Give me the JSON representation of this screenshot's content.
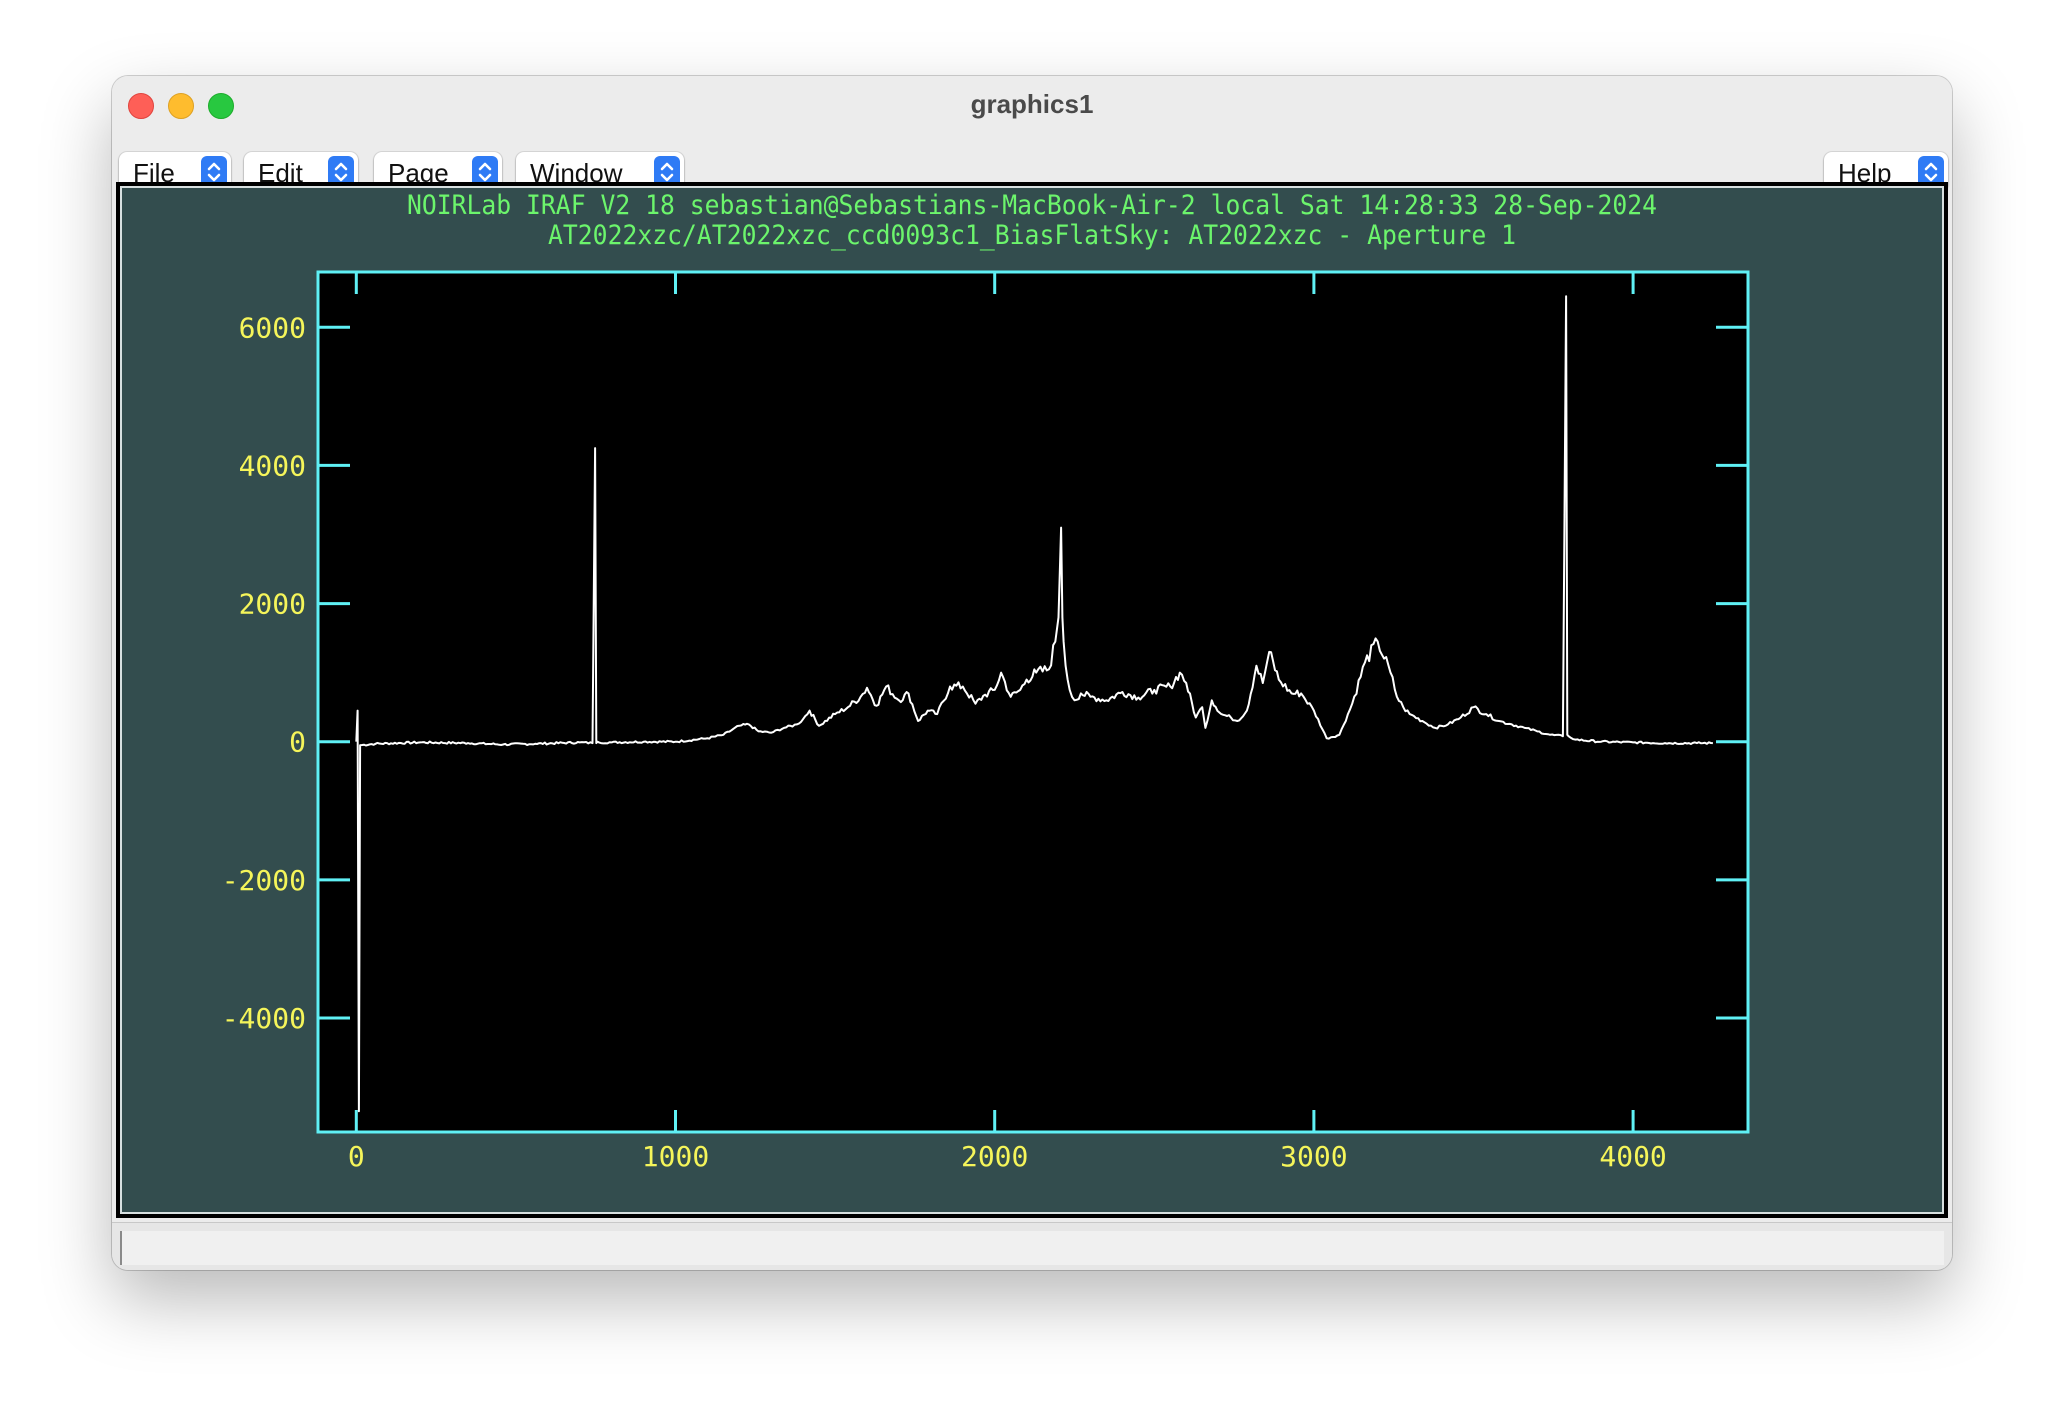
{
  "window": {
    "title": "graphics1"
  },
  "menus": {
    "file": "File",
    "edit": "Edit",
    "page": "Page",
    "window": "Window",
    "help": "Help"
  },
  "status": {
    "text": ""
  },
  "colors": {
    "plot_background": "#000000",
    "frame_background": "#334d4e",
    "axes": "#5ff0f5",
    "tick_labels": "#f5f55a",
    "title_text": "#6cf56c",
    "trace": "#ffffff",
    "menu_spinner": "#2f7bf5"
  },
  "icons": {
    "close": "close-traffic-light-icon",
    "minimize": "minimize-traffic-light-icon",
    "zoom": "zoom-traffic-light-icon",
    "menu_spinner": "chevron-updown-icon"
  },
  "chart_data": {
    "type": "line",
    "title": "NOIRLab IRAF V2 18 sebastian@Sebastians-MacBook-Air-2 local Sat 14:28:33 28-Sep-2024",
    "subtitle": "AT2022xzc/AT2022xzc_ccd0093c1_BiasFlatSky: AT2022xzc - Aperture 1",
    "xlabel": "",
    "ylabel": "",
    "xlim": [
      -120,
      4360
    ],
    "ylim": [
      -5650,
      6800
    ],
    "x_ticks": [
      0,
      1000,
      2000,
      3000,
      4000
    ],
    "x_tick_labels": [
      "0",
      "1000",
      "2000",
      "3000",
      "4000"
    ],
    "y_ticks": [
      -4000,
      -2000,
      0,
      2000,
      4000,
      6000
    ],
    "y_tick_labels": [
      "-4000",
      "-2000",
      "0",
      "2000",
      "4000",
      "6000"
    ],
    "grid": false,
    "series": [
      {
        "x": [
          0,
          4,
          8,
          12,
          60,
          200,
          350,
          460,
          560,
          700,
          740,
          748,
          752,
          756,
          760,
          800,
          900,
          1000,
          1100,
          1150,
          1200,
          1230,
          1260,
          1300,
          1340,
          1380,
          1400,
          1420,
          1450,
          1500,
          1540,
          1580,
          1600,
          1630,
          1660,
          1700,
          1730,
          1760,
          1790,
          1820,
          1860,
          1900,
          1940,
          1970,
          2000,
          2020,
          2050,
          2080,
          2100,
          2130,
          2170,
          2190,
          2200,
          2208,
          2212,
          2216,
          2222,
          2235,
          2250,
          2270,
          2300,
          2350,
          2400,
          2450,
          2500,
          2550,
          2580,
          2600,
          2630,
          2650,
          2660,
          2680,
          2710,
          2740,
          2760,
          2790,
          2820,
          2840,
          2860,
          2890,
          2930,
          2960,
          3000,
          3040,
          3080,
          3120,
          3160,
          3200,
          3240,
          3260,
          3280,
          3300,
          3340,
          3380,
          3420,
          3460,
          3500,
          3540,
          3580,
          3620,
          3660,
          3700,
          3740,
          3780,
          3790,
          3794,
          3798,
          3820,
          3900,
          4000,
          4100,
          4200,
          4250
        ],
        "y": [
          0,
          450,
          -5350,
          -50,
          -30,
          -10,
          -20,
          -40,
          -30,
          -10,
          -20,
          4250,
          -20,
          0,
          -10,
          -10,
          0,
          0,
          50,
          100,
          230,
          250,
          150,
          130,
          200,
          250,
          330,
          450,
          230,
          400,
          500,
          650,
          780,
          520,
          800,
          600,
          700,
          300,
          450,
          400,
          800,
          800,
          550,
          680,
          750,
          1000,
          650,
          750,
          900,
          1000,
          1050,
          1450,
          1800,
          3100,
          1800,
          1450,
          1100,
          750,
          600,
          700,
          650,
          600,
          720,
          640,
          750,
          800,
          1000,
          850,
          350,
          500,
          200,
          600,
          400,
          350,
          300,
          450,
          1100,
          850,
          1300,
          900,
          700,
          700,
          450,
          50,
          100,
          550,
          1150,
          1450,
          1000,
          650,
          500,
          400,
          300,
          200,
          250,
          350,
          500,
          400,
          300,
          250,
          200,
          150,
          100,
          80,
          6450,
          100,
          80,
          30,
          0,
          -10,
          -20,
          -20,
          -20
        ]
      }
    ]
  }
}
